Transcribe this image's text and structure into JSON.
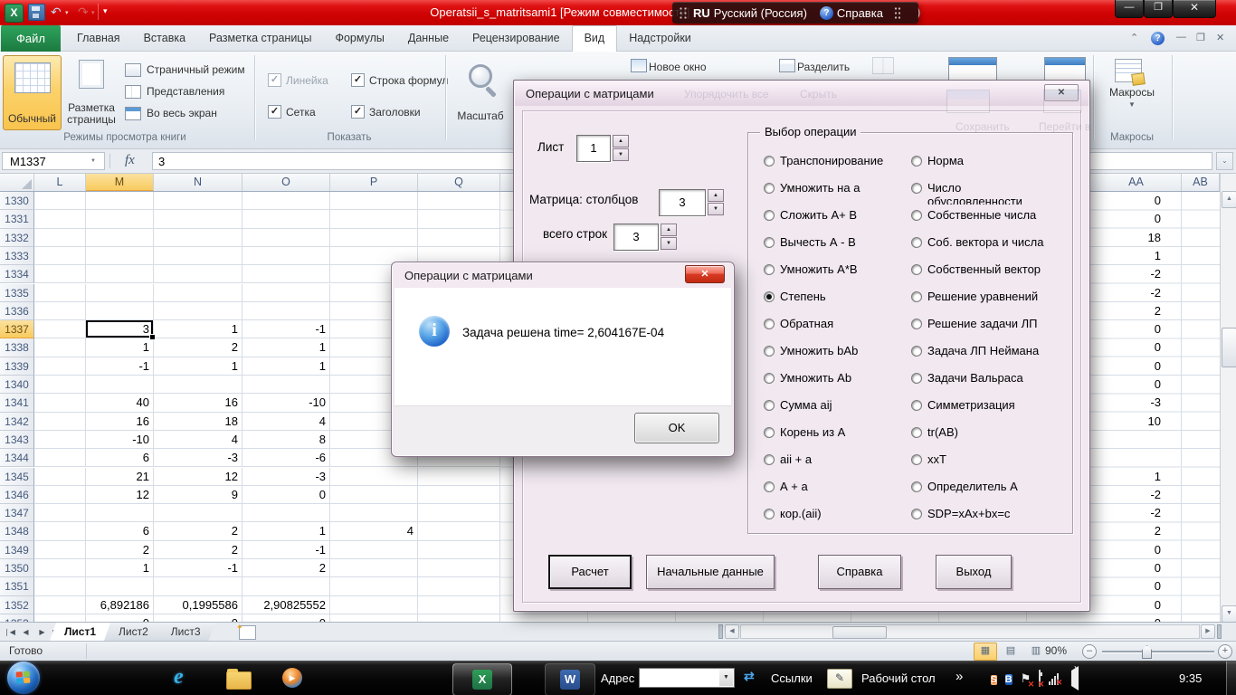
{
  "titlebar": {
    "title_left": "Operatsii_s_matritsami1  [Режим совместимости] - M",
    "title_right": ")",
    "lang": {
      "code": "RU",
      "name": "Русский (Россия)",
      "help_label": "Справка"
    }
  },
  "ribbon_tabs": {
    "file": "Файл",
    "items": [
      "Главная",
      "Вставка",
      "Разметка страницы",
      "Формулы",
      "Данные",
      "Рецензирование",
      "Вид",
      "Надстройки"
    ],
    "active": "Вид"
  },
  "ribbon": {
    "view_group": {
      "label": "Режимы просмотра книги",
      "normal": "Обычный",
      "page_layout": "Разметка страницы",
      "small": [
        "Страничный режим",
        "Представления",
        "Во весь экран"
      ]
    },
    "show_group": {
      "label": "Показать",
      "checks": [
        {
          "label": "Линейка",
          "checked": true,
          "disabled": true
        },
        {
          "label": "Строка формул",
          "checked": true,
          "disabled": false
        },
        {
          "label": "Сетка",
          "checked": true,
          "disabled": false
        },
        {
          "label": "Заголовки",
          "checked": true,
          "disabled": false
        }
      ]
    },
    "zoom_button": "Масштаб",
    "window_items": [
      "Новое окно",
      "Разделить"
    ],
    "ghosts": [
      "Упорядочить все",
      "Скрыть",
      "Сохранить",
      "Перейти в"
    ],
    "macros": {
      "button": "Макросы",
      "group": "Макросы"
    }
  },
  "formula_bar": {
    "name_box": "M1337",
    "fx": "fx",
    "value": "3"
  },
  "grid": {
    "columns": [
      "L",
      "M",
      "N",
      "O",
      "P",
      "Q"
    ],
    "right_columns": [
      "AA",
      "AB"
    ],
    "selected_column": "M",
    "selected_row": 1337,
    "rows": [
      {
        "n": 1330,
        "cells": [
          "",
          "",
          "",
          ""
        ],
        "aa": "0"
      },
      {
        "n": 1331,
        "cells": [
          "",
          "",
          "",
          ""
        ],
        "aa": "0"
      },
      {
        "n": 1332,
        "cells": [
          "",
          "",
          "",
          ""
        ],
        "aa": "18"
      },
      {
        "n": 1333,
        "cells": [
          "",
          "",
          "",
          ""
        ],
        "aa": "1"
      },
      {
        "n": 1334,
        "cells": [
          "",
          "",
          "",
          ""
        ],
        "aa": "-2"
      },
      {
        "n": 1335,
        "cells": [
          "",
          "",
          "",
          ""
        ],
        "aa": "-2"
      },
      {
        "n": 1336,
        "cells": [
          "",
          "",
          "",
          ""
        ],
        "aa": "2"
      },
      {
        "n": 1337,
        "cells": [
          "3",
          "1",
          "-1",
          ""
        ],
        "aa": "0"
      },
      {
        "n": 1338,
        "cells": [
          "1",
          "2",
          "1",
          ""
        ],
        "aa": "0"
      },
      {
        "n": 1339,
        "cells": [
          "-1",
          "1",
          "1",
          ""
        ],
        "aa": "0"
      },
      {
        "n": 1340,
        "cells": [
          "",
          "",
          "",
          ""
        ],
        "aa": "0"
      },
      {
        "n": 1341,
        "cells": [
          "40",
          "16",
          "-10",
          ""
        ],
        "aa": "-3"
      },
      {
        "n": 1342,
        "cells": [
          "16",
          "18",
          "4",
          ""
        ],
        "aa": "10"
      },
      {
        "n": 1343,
        "cells": [
          "-10",
          "4",
          "8",
          ""
        ],
        "aa": ""
      },
      {
        "n": 1344,
        "cells": [
          "6",
          "-3",
          "-6",
          ""
        ],
        "aa": ""
      },
      {
        "n": 1345,
        "cells": [
          "21",
          "12",
          "-3",
          ""
        ],
        "aa": "1"
      },
      {
        "n": 1346,
        "cells": [
          "12",
          "9",
          "0",
          ""
        ],
        "aa": "-2"
      },
      {
        "n": 1347,
        "cells": [
          "",
          "",
          "",
          ""
        ],
        "aa": "-2"
      },
      {
        "n": 1348,
        "cells": [
          "6",
          "2",
          "1",
          "4"
        ],
        "aa": "2"
      },
      {
        "n": 1349,
        "cells": [
          "2",
          "2",
          "-1",
          ""
        ],
        "aa": "0"
      },
      {
        "n": 1350,
        "cells": [
          "1",
          "-1",
          "2",
          ""
        ],
        "aa": "0"
      },
      {
        "n": 1351,
        "cells": [
          "",
          "",
          "",
          ""
        ],
        "aa": "0"
      },
      {
        "n": 1352,
        "cells": [
          "6,892186",
          "0,1995586",
          "2,90825552",
          ""
        ],
        "aa": "0"
      },
      {
        "n": 1353,
        "cells": [
          "0",
          "0",
          "0",
          ""
        ],
        "aa": "0"
      }
    ]
  },
  "sheet_tabs": {
    "items": [
      "Лист1",
      "Лист2",
      "Лист3"
    ],
    "active": "Лист1"
  },
  "status_bar": {
    "mode": "Готово",
    "zoom": "90%"
  },
  "taskbar": {
    "address_label": "Адрес",
    "links_label": "Ссылки",
    "desktop_label": "Рабочий стол",
    "time": "9:35"
  },
  "dialog": {
    "title": "Операции с матрицами",
    "sheet_label": "Лист",
    "sheet_value": "1",
    "cols_label": "Матрица: столбцов",
    "cols_value": "3",
    "rows_label": "всего строк",
    "rows_value": "3",
    "group_label": "Выбор операции",
    "selected_radio": "Степень",
    "radios_left": [
      "Транспонирование",
      "Умножить на а",
      "Сложить А+ В",
      "Вычесть А - В",
      "Умножить А*В",
      "Степень",
      "Обратная",
      "Умножить bAb",
      "Умножить Ab",
      "Сумма aij",
      "Корень из А",
      "аii + a",
      "А + а",
      "кор.(аii)"
    ],
    "radios_right": [
      "Норма",
      "Число обусловленности",
      "Собственные числа",
      "Соб. вектора и числа",
      "Собственный вектор",
      "Решение уравнений",
      "Решение задачи ЛП",
      "Задача ЛП Неймана",
      "Задачи Вальраса",
      "Симметризация",
      "tr(АВ)",
      "xxT",
      "Определитель А",
      "SDP=xAx+bx=c"
    ],
    "buttons": [
      "Расчет",
      "Начальные данные",
      "Справка",
      "Выход"
    ]
  },
  "msgbox": {
    "title": "Операции с матрицами",
    "text": "Задача решена  time= 2,604167E-04",
    "ok_label": "OK"
  }
}
